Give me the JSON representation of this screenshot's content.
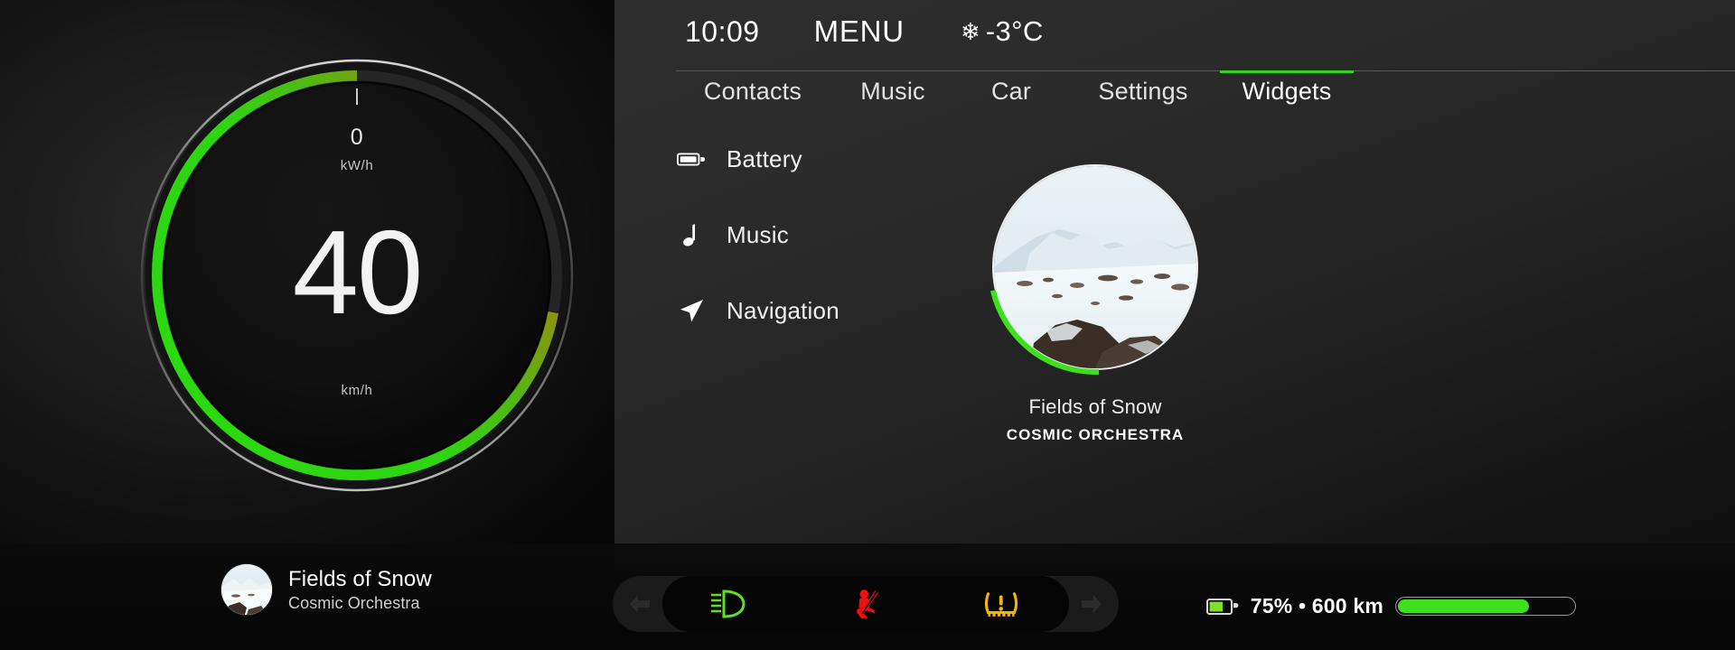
{
  "theme": {
    "accent_green": "#36d11a",
    "bright_green": "#3ee01e",
    "warn_red": "#ee1111",
    "warn_yellow": "#f5b800",
    "bg_dark": "#0a0a0a"
  },
  "header": {
    "time": "10:09",
    "title": "MENU",
    "temp_icon": "snowflake-icon",
    "temperature": "-3°C"
  },
  "tabs": [
    {
      "label": "Contacts",
      "active": false
    },
    {
      "label": "Music",
      "active": false
    },
    {
      "label": "Car",
      "active": false
    },
    {
      "label": "Settings",
      "active": false
    },
    {
      "label": "Widgets",
      "active": true
    }
  ],
  "widget_list": [
    {
      "label": "Battery",
      "icon": "battery-icon"
    },
    {
      "label": "Music",
      "icon": "music-note-icon"
    },
    {
      "label": "Navigation",
      "icon": "navigation-arrow-icon"
    }
  ],
  "gauge": {
    "speed_value": "40",
    "speed_unit": "km/h",
    "power_value": "0",
    "power_unit": "kW/h",
    "arc_percent": 72,
    "arc_color_start": "#7a7a10",
    "arc_color_end": "#2fd412"
  },
  "album_widget": {
    "title": "Fields of Snow",
    "artist": "COSMIC ORCHESTRA",
    "progress_percent": 22,
    "progress_color": "#3ee01e",
    "art_alt": "snowy-mountain-landscape"
  },
  "now_playing_mini": {
    "title": "Fields of Snow",
    "artist": "Cosmic Orchestra",
    "art_alt": "snowy-mountain-landscape"
  },
  "telltales": {
    "left_arrow": "arrow-left-icon",
    "right_arrow": "arrow-right-icon",
    "indicators": [
      {
        "name": "headlight-low-beam-icon",
        "color": "#5ee01e"
      },
      {
        "name": "seatbelt-warning-icon",
        "color": "#ee1111"
      },
      {
        "name": "tire-pressure-warning-icon",
        "color": "#f5b800"
      }
    ]
  },
  "battery_status": {
    "icon": "battery-icon",
    "icon_fill_percent": 60,
    "text": "75% • 600 km",
    "bar_percent": 75,
    "bar_color": "#3ee01e"
  }
}
